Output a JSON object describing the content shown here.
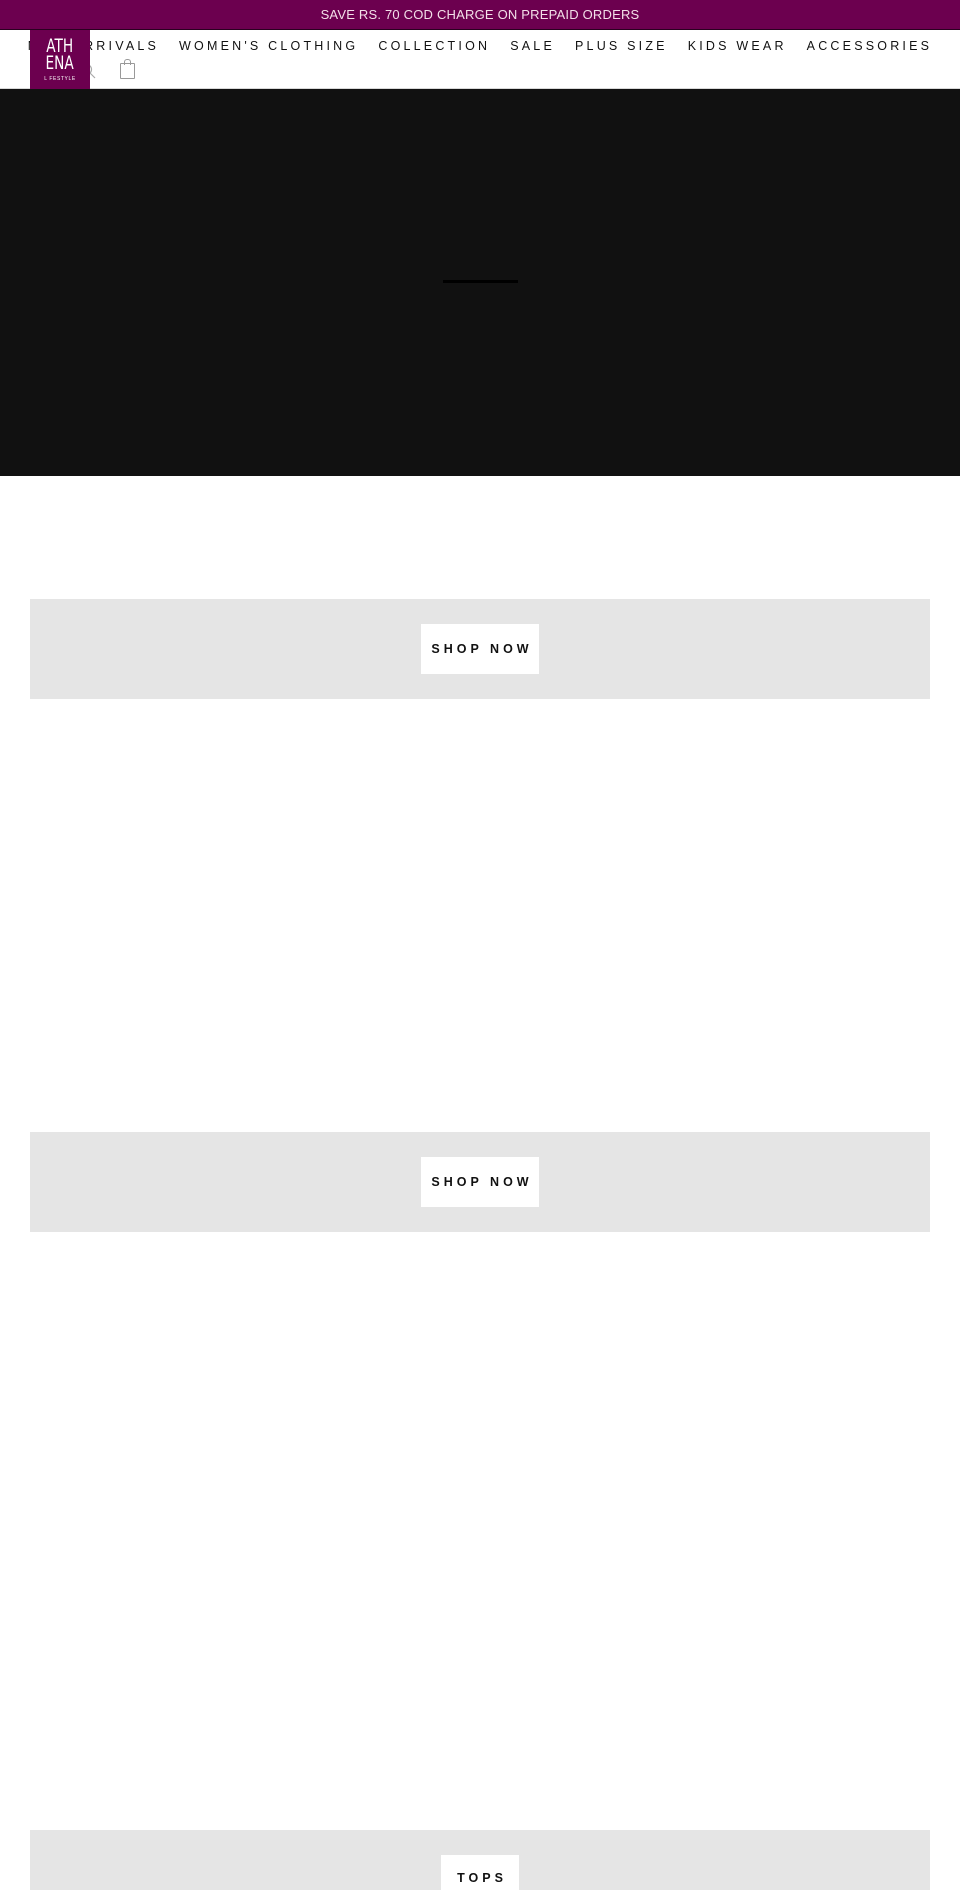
{
  "announcement": {
    "text": "SAVE RS. 70 COD CHARGE ON PREPAID ORDERS"
  },
  "brand": {
    "logo_line1": "ATH",
    "logo_line2": "ENA",
    "logo_tagline": "L FESTYLE",
    "color": "#6c004f"
  },
  "nav": {
    "items": [
      {
        "label": "NEW ARRIVALS"
      },
      {
        "label": "WOMEN'S CLOTHING"
      },
      {
        "label": "COLLECTION"
      },
      {
        "label": "SALE"
      },
      {
        "label": "PLUS SIZE"
      },
      {
        "label": "KIDS WEAR"
      },
      {
        "label": "ACCESSORIES"
      }
    ],
    "icons": [
      "search-icon",
      "cart-icon"
    ]
  },
  "hero": {
    "state": "loading"
  },
  "promos": [
    {
      "button_label": "SHOP NOW"
    },
    {
      "button_label": "SHOP NOW"
    },
    {
      "button_label": "TOPS"
    }
  ]
}
